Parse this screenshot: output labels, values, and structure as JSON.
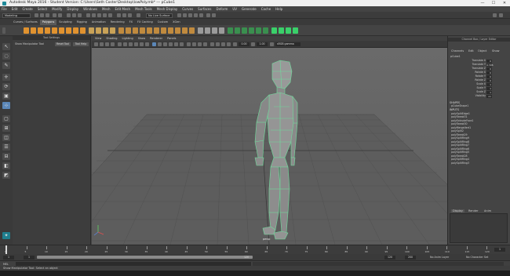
{
  "titlebar": {
    "title": "Autodesk Maya 2016 - Student Version: C:\\Users\\Seth Coster\\Desktop\\lowPoly.mb* --- pCube1",
    "min": "—",
    "max": "☐",
    "close": "✕"
  },
  "menubar": {
    "items": [
      "File",
      "Edit",
      "Create",
      "Select",
      "Modify",
      "Display",
      "Windows",
      "Mesh",
      "Edit Mesh",
      "Mesh Tools",
      "Mesh Display",
      "Curves",
      "Surfaces",
      "Deform",
      "UV",
      "Generate",
      "Cache",
      "Help"
    ]
  },
  "statusline": {
    "workspace": "Modeling",
    "live_surface": "No Live Surface"
  },
  "shelf": {
    "tabs": [
      "Curves / Surfaces",
      "Polygons",
      "Sculpting",
      "Rigging",
      "Animation",
      "Rendering",
      "FX",
      "FX Caching",
      "Custom",
      "XGen"
    ],
    "active_tab": "Polygons"
  },
  "outliner": {
    "header": "Tool Settings",
    "tool_name": "Show Manipulator Tool",
    "reset_label": "Reset Tool",
    "help_label": "Tool Help"
  },
  "viewport": {
    "menu": [
      "View",
      "Shading",
      "Lighting",
      "Show",
      "Renderer",
      "Panels"
    ],
    "exposure": "0.00",
    "gamma": "1.00",
    "color_space": "sRGB gamma",
    "camera_label": "persp",
    "accent": "#6fdc9c"
  },
  "channelbox": {
    "header": "Channel Box / Layer Editor",
    "menu": [
      "Channels",
      "Edit",
      "Object",
      "Show"
    ],
    "object_name": "pCube1",
    "attributes": [
      {
        "name": "Translate X",
        "value": "0"
      },
      {
        "name": "Translate Y",
        "value": "4.396"
      },
      {
        "name": "Translate Z",
        "value": "0"
      },
      {
        "name": "Rotate X",
        "value": "0"
      },
      {
        "name": "Rotate Y",
        "value": "0"
      },
      {
        "name": "Rotate Z",
        "value": "0"
      },
      {
        "name": "Scale X",
        "value": "1"
      },
      {
        "name": "Scale Y",
        "value": "1"
      },
      {
        "name": "Scale Z",
        "value": "1"
      },
      {
        "name": "Visibility",
        "value": "on"
      }
    ],
    "shapes_label": "SHAPES",
    "shape_node": "pCubeShape1",
    "inputs_label": "INPUTS",
    "inputs": [
      "polySplitEdge1",
      "polyTweak31",
      "polyExtrudeFace1",
      "polyTweak30",
      "polyMergeVert1",
      "polySplit2",
      "polyTweak29",
      "polySplitRing9",
      "polySplitRing8",
      "polySplitRing7",
      "polySplitRing6",
      "polySplitRing5",
      "polyTweak28",
      "polySplitRing4",
      "polySplitRing3"
    ]
  },
  "layers": {
    "tabs": [
      "Display",
      "Render",
      "Anim"
    ],
    "menu": [
      "Layers",
      "Options",
      "Help"
    ]
  },
  "timeline": {
    "ticks": [
      "1",
      "5",
      "10",
      "15",
      "20",
      "25",
      "30",
      "35",
      "40",
      "45",
      "50",
      "55",
      "60",
      "65",
      "70",
      "75",
      "80",
      "85",
      "90",
      "95",
      "100",
      "105",
      "110",
      "115",
      "120"
    ],
    "current_frame": "1"
  },
  "range": {
    "start": "1",
    "inner_start": "1",
    "inner_end": "120",
    "end": "120",
    "max": "200",
    "anim_layer": "No Anim Layer",
    "char_set": "No Character Set"
  },
  "cmdline": {
    "lang": "MEL"
  },
  "helpline": {
    "text": "Show Manipulator Tool: Select an object"
  }
}
